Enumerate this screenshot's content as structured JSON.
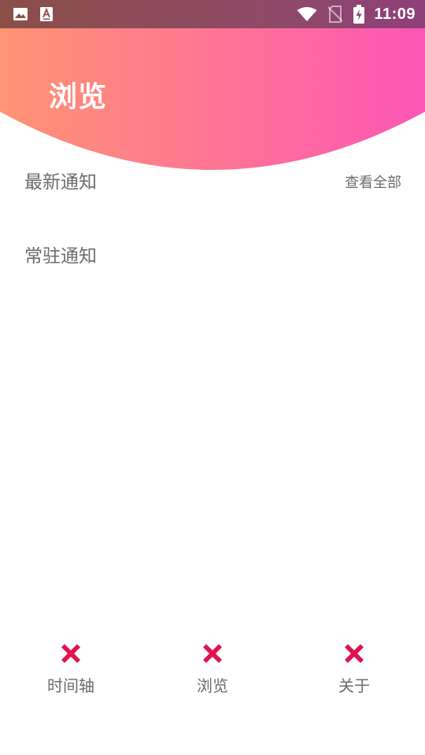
{
  "status_bar": {
    "left_icons": [
      "image-icon",
      "app-notification-icon"
    ],
    "right_icons": [
      "wifi-icon",
      "no-sim-icon",
      "battery-charging-icon"
    ],
    "time": "11:09"
  },
  "header": {
    "title": "浏览",
    "gradient_start": "#ff9472",
    "gradient_end": "#fd56b5"
  },
  "sections": {
    "latest": {
      "title": "最新通知",
      "view_all": "查看全部"
    },
    "pinned": {
      "title": "常驻通知"
    }
  },
  "bottom_nav": {
    "icon_color": "#e0134f",
    "items": [
      {
        "label": "时间轴",
        "icon": "close-x-icon"
      },
      {
        "label": "浏览",
        "icon": "close-x-icon"
      },
      {
        "label": "关于",
        "icon": "close-x-icon"
      }
    ]
  }
}
